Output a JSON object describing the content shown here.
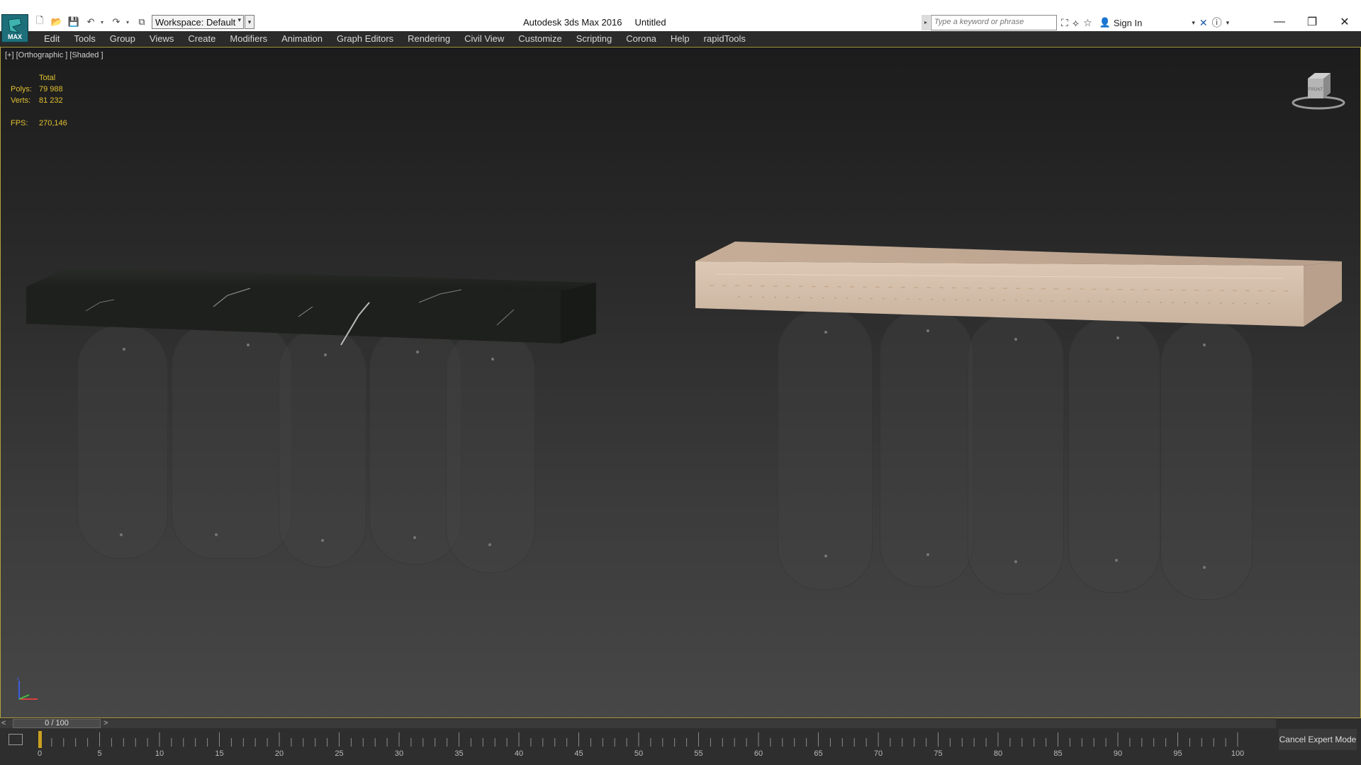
{
  "title_bar": {
    "logo_text": "MAX",
    "workspace": "Workspace: Default",
    "app_title": "Autodesk 3ds Max 2016",
    "doc_title": "Untitled",
    "search_placeholder": "Type a keyword or phrase",
    "sign_in": "Sign In"
  },
  "menu": [
    "Edit",
    "Tools",
    "Group",
    "Views",
    "Create",
    "Modifiers",
    "Animation",
    "Graph Editors",
    "Rendering",
    "Civil View",
    "Customize",
    "Scripting",
    "Corona",
    "Help",
    "rapidTools"
  ],
  "viewport": {
    "label": "[+] [Orthographic ] [Shaded ]",
    "stats_header": "Total",
    "polys_label": "Polys:",
    "polys": "79 988",
    "verts_label": "Verts:",
    "verts": "81 232",
    "fps_label": "FPS:",
    "fps": "270,146",
    "viewcube_label": "FRONT",
    "materials": {
      "dark_marble": "#1f211e",
      "light_travertine": "#c9b29c"
    }
  },
  "timeline": {
    "prev": "<",
    "position": "0 / 100",
    "next": ">",
    "ticks": [
      "0",
      "5",
      "10",
      "15",
      "20",
      "25",
      "30",
      "35",
      "40",
      "45",
      "50",
      "55",
      "60",
      "65",
      "70",
      "75",
      "80",
      "85",
      "90",
      "95",
      "100"
    ],
    "cancel_expert": "Cancel Expert Mode"
  }
}
